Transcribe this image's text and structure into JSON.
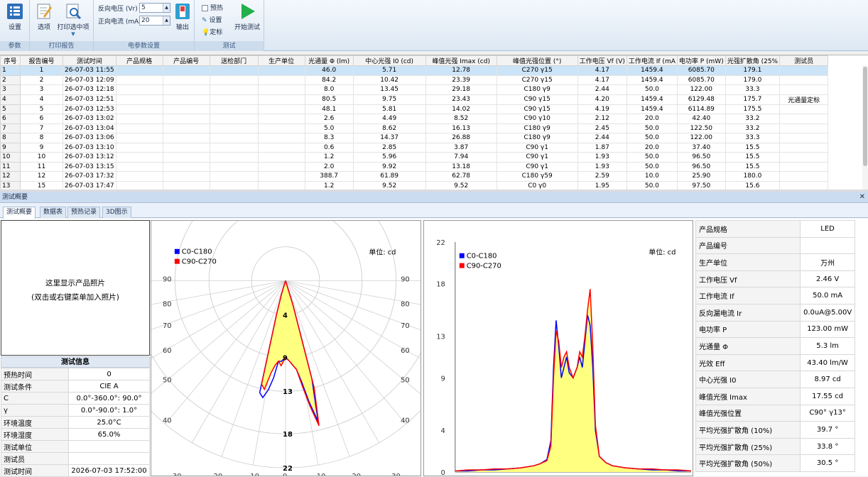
{
  "ribbon": {
    "groups": [
      {
        "label": "参数",
        "buttons": [
          "设置"
        ]
      },
      {
        "label": "打印报告",
        "buttons": [
          "选项",
          "打印选中项"
        ]
      },
      {
        "label": "电参数设置",
        "buttons": [
          "输出"
        ]
      },
      {
        "label": "测试",
        "buttons": [
          "开始测试"
        ]
      }
    ],
    "reverse_voltage_label": "反向电压 (Vr)",
    "reverse_voltage_value": "5",
    "forward_current_label": "正向电流 (mA",
    "forward_current_value": "20",
    "checks": [
      "预热",
      "设置",
      "定标"
    ]
  },
  "grid": {
    "columns": [
      "序号",
      "报告编号",
      "测试时间",
      "产品规格",
      "产品编号",
      "送检部门",
      "生产单位",
      "光通量 Φ (lm)",
      "中心光强 I0 (cd)",
      "峰值光强 Imax (cd)",
      "峰值光强位置 (°)",
      "工作电压 Vf (V)",
      "工作电流 If (mA",
      "电功率 P (mW)",
      "光强扩散角 (25%",
      "测试员"
    ],
    "rows": [
      [
        "1",
        "1",
        "26-07-03 11:55",
        "",
        "",
        "",
        "",
        "46.0",
        "5.71",
        "12.78",
        "C270 γ15",
        "4.17",
        "1459.4",
        "6085.70",
        "179.1",
        ""
      ],
      [
        "2",
        "2",
        "26-07-03 12:09",
        "",
        "",
        "",
        "",
        "84.2",
        "10.42",
        "23.39",
        "C270 γ15",
        "4.17",
        "1459.4",
        "6085.70",
        "179.0",
        ""
      ],
      [
        "3",
        "3",
        "26-07-03 12:18",
        "",
        "",
        "",
        "",
        "8.0",
        "13.45",
        "29.18",
        "C180 γ9",
        "2.44",
        "50.0",
        "122.00",
        "33.3",
        ""
      ],
      [
        "4",
        "4",
        "26-07-03 12:51",
        "",
        "",
        "",
        "",
        "80.5",
        "9.75",
        "23.43",
        "C90 γ15",
        "4.20",
        "1459.4",
        "6129.48",
        "175.7",
        "光通量定标"
      ],
      [
        "5",
        "5",
        "26-07-03 12:53",
        "",
        "",
        "",
        "",
        "48.1",
        "5.81",
        "14.02",
        "C90 γ15",
        "4.19",
        "1459.4",
        "6114.89",
        "175.5",
        ""
      ],
      [
        "6",
        "6",
        "26-07-03 13:02",
        "",
        "",
        "",
        "",
        "2.6",
        "4.49",
        "8.52",
        "C90 γ10",
        "2.12",
        "20.0",
        "42.40",
        "33.2",
        ""
      ],
      [
        "7",
        "7",
        "26-07-03 13:04",
        "",
        "",
        "",
        "",
        "5.0",
        "8.62",
        "16.13",
        "C180 γ9",
        "2.45",
        "50.0",
        "122.50",
        "33.2",
        ""
      ],
      [
        "8",
        "8",
        "26-07-03 13:06",
        "",
        "",
        "",
        "",
        "8.3",
        "14.37",
        "26.88",
        "C180 γ9",
        "2.44",
        "50.0",
        "122.00",
        "33.3",
        ""
      ],
      [
        "9",
        "9",
        "26-07-03 13:10",
        "",
        "",
        "",
        "",
        "0.6",
        "2.85",
        "3.87",
        "C90 γ1",
        "1.87",
        "20.0",
        "37.40",
        "15.5",
        ""
      ],
      [
        "10",
        "10",
        "26-07-03 13:12",
        "",
        "",
        "",
        "",
        "1.2",
        "5.96",
        "7.94",
        "C90 γ1",
        "1.93",
        "50.0",
        "96.50",
        "15.5",
        ""
      ],
      [
        "11",
        "11",
        "26-07-03 13:15",
        "",
        "",
        "",
        "",
        "2.0",
        "9.92",
        "13.18",
        "C90 γ1",
        "1.93",
        "50.0",
        "96.50",
        "15.5",
        ""
      ],
      [
        "12",
        "12",
        "26-07-03 17:32",
        "",
        "",
        "",
        "",
        "388.7",
        "61.89",
        "62.78",
        "C180 γ59",
        "2.59",
        "10.0",
        "25.90",
        "180.0",
        ""
      ],
      [
        "13",
        "15",
        "26-07-03 17:47",
        "",
        "",
        "",
        "",
        "1.2",
        "9.52",
        "9.52",
        "C0 γ0",
        "1.95",
        "50.0",
        "97.50",
        "15.6",
        ""
      ]
    ]
  },
  "panel": {
    "title": "测试概要",
    "tabs": [
      "测试概要",
      "数据表",
      "预热记录",
      "3D图示"
    ],
    "photo_line1": "这里显示产品照片",
    "photo_line2": "(双击或右键菜单加入照片)"
  },
  "test_info": {
    "title": "测试信息",
    "rows": [
      {
        "k": "预热时间",
        "v": "0"
      },
      {
        "k": "测试条件",
        "v": "CIE A"
      },
      {
        "k": "C",
        "v": "0.0°-360.0°: 90.0°"
      },
      {
        "k": "γ",
        "v": "0.0°-90.0°: 1.0°"
      },
      {
        "k": "环境温度",
        "v": "25.0°C"
      },
      {
        "k": "环境湿度",
        "v": "65.0%"
      },
      {
        "k": "测试单位",
        "v": ""
      },
      {
        "k": "测试员",
        "v": ""
      },
      {
        "k": "测试时间",
        "v": "2026-07-03 17:52:00"
      }
    ]
  },
  "params": [
    {
      "k": "产品规格",
      "v": "LED"
    },
    {
      "k": "产品编号",
      "v": ""
    },
    {
      "k": "生产单位",
      "v": "万州"
    },
    {
      "k": "工作电压 Vf",
      "v": "2.46 V"
    },
    {
      "k": "工作电流 If",
      "v": "50.0 mA"
    },
    {
      "k": "反向漏电流 Ir",
      "v": "0.0uA@5.00V"
    },
    {
      "k": "电功率 P",
      "v": "123.00 mW"
    },
    {
      "k": "光通量 Φ",
      "v": "5.3 lm"
    },
    {
      "k": "光效 Eff",
      "v": "43.40 lm/W"
    },
    {
      "k": "中心光强 I0",
      "v": "8.97 cd"
    },
    {
      "k": "峰值光强 Imax",
      "v": "17.55 cd"
    },
    {
      "k": "峰值光强位置",
      "v": "C90° γ13°"
    },
    {
      "k": "平均光强扩散角 (10%)",
      "v": "39.7 °"
    },
    {
      "k": "平均光强扩散角 (25%)",
      "v": "33.8 °"
    },
    {
      "k": "平均光强扩散角 (50%)",
      "v": "30.5 °"
    }
  ],
  "colors": {
    "series1": "#0000ff",
    "series2": "#ff0000",
    "fill": "#ffff80"
  },
  "chart_data": [
    {
      "type": "polar",
      "unit_label": "单位: cd",
      "legend": [
        "C0-C180",
        "C90-C270"
      ],
      "radial_ticks": [
        "4",
        "9",
        "13",
        "18",
        "22"
      ],
      "angle_ticks": [
        "90",
        "80",
        "70",
        "60",
        "50",
        "40"
      ],
      "bottom_ticks": [
        "30",
        "20",
        "10",
        "0",
        "10",
        "20",
        "30"
      ],
      "rmax": 22,
      "series": [
        {
          "name": "C0-C180",
          "angles": [
            -20,
            -17,
            -15,
            -13,
            -11,
            -9,
            -7,
            -5,
            -3,
            0,
            3,
            5,
            7,
            9,
            11,
            13,
            15,
            17,
            20
          ],
          "values": [
            0,
            1.5,
            4,
            13.5,
            14,
            13,
            11.5,
            9.5,
            9.5,
            9,
            9.5,
            10,
            10.5,
            12,
            14.5,
            17,
            12,
            3,
            0
          ]
        },
        {
          "name": "C90-C270",
          "angles": [
            -20,
            -17,
            -15,
            -13,
            -11,
            -9,
            -7,
            -5,
            -3,
            0,
            3,
            5,
            7,
            9,
            11,
            13,
            15,
            17,
            20
          ],
          "values": [
            0,
            1.5,
            4,
            12.5,
            13,
            11,
            10,
            9.5,
            10,
            9,
            9.5,
            10,
            10.5,
            12.5,
            15,
            17.5,
            13,
            3,
            0
          ]
        }
      ]
    },
    {
      "type": "line",
      "unit_label": "单位: cd",
      "legend": [
        "C0-C180",
        "C90-C270"
      ],
      "ylim": [
        0,
        22
      ],
      "yticks": [
        0,
        4,
        9,
        13,
        18,
        22
      ],
      "xlim": [
        -90,
        90
      ],
      "series": [
        {
          "name": "C0-C180",
          "x": [
            -90,
            -80,
            -70,
            -60,
            -50,
            -40,
            -30,
            -25,
            -20,
            -17,
            -15,
            -13,
            -11,
            -9,
            -7,
            -5,
            -3,
            0,
            3,
            5,
            7,
            9,
            11,
            13,
            15,
            17,
            20,
            25,
            30,
            40,
            50,
            60,
            70,
            80,
            90
          ],
          "values": [
            0.1,
            0.1,
            0.2,
            0.2,
            0.3,
            0.4,
            0.6,
            0.8,
            1.2,
            3,
            10,
            14.5,
            12,
            9,
            10,
            11,
            9.5,
            9,
            10,
            11,
            10,
            12.5,
            15,
            14,
            10,
            4,
            1.5,
            0.9,
            0.6,
            0.4,
            0.3,
            0.2,
            0.2,
            0.1,
            0.1
          ]
        },
        {
          "name": "C90-C270",
          "x": [
            -90,
            -80,
            -70,
            -60,
            -50,
            -40,
            -30,
            -25,
            -20,
            -17,
            -15,
            -13,
            -11,
            -9,
            -7,
            -5,
            -3,
            0,
            3,
            5,
            7,
            9,
            11,
            13,
            15,
            17,
            20,
            25,
            30,
            40,
            50,
            60,
            70,
            80,
            90
          ],
          "values": [
            0.1,
            0.2,
            0.2,
            0.3,
            0.3,
            0.4,
            0.6,
            0.8,
            1.1,
            2.5,
            9,
            13.5,
            12.5,
            10,
            11,
            11.5,
            10,
            9,
            10,
            11.5,
            11,
            13,
            15.5,
            17.5,
            12,
            4.5,
            1.5,
            0.9,
            0.6,
            0.4,
            0.3,
            0.3,
            0.2,
            0.2,
            0.1
          ]
        }
      ]
    }
  ]
}
